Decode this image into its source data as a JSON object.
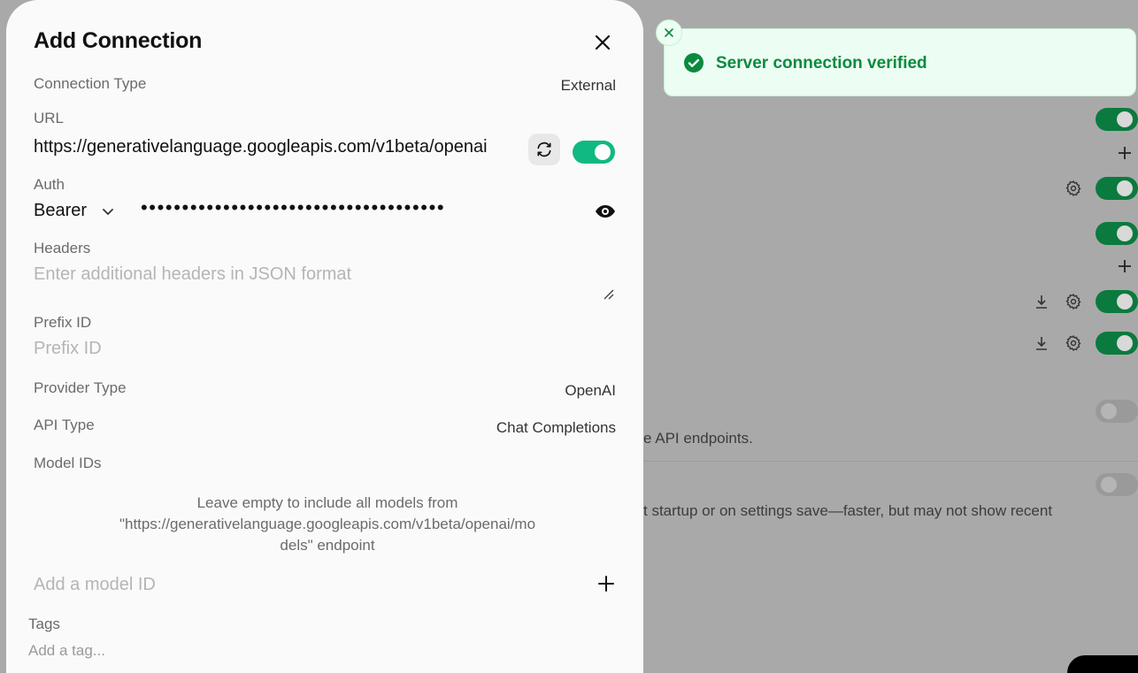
{
  "background": {
    "description_text_1": "e API endpoints.",
    "description_text_2": "t startup or on settings save—faster, but may not show recent"
  },
  "modal": {
    "title": "Add Connection",
    "connection_type": {
      "label": "Connection Type",
      "value": "External"
    },
    "url": {
      "label": "URL",
      "value": "https://generativelanguage.googleapis.com/v1beta/openai"
    },
    "auth": {
      "label": "Auth",
      "type": "Bearer",
      "key_masked": "•••••••••••••••••••••••••••••••••••••"
    },
    "headers": {
      "label": "Headers",
      "placeholder": "Enter additional headers in JSON format"
    },
    "prefix_id": {
      "label": "Prefix ID",
      "placeholder": "Prefix ID"
    },
    "provider_type": {
      "label": "Provider Type",
      "value": "OpenAI"
    },
    "api_type": {
      "label": "API Type",
      "value": "Chat Completions"
    },
    "model_ids": {
      "label": "Model IDs",
      "help_line_1": "Leave empty to include all models from",
      "help_line_2": "\"https://generativelanguage.googleapis.com/v1beta/openai/mo",
      "help_line_3": "dels\" endpoint",
      "placeholder": "Add a model ID"
    },
    "tags": {
      "label": "Tags",
      "placeholder": "Add a tag..."
    }
  },
  "toast": {
    "message": "Server connection verified",
    "status_color": "#0b8a3e"
  }
}
